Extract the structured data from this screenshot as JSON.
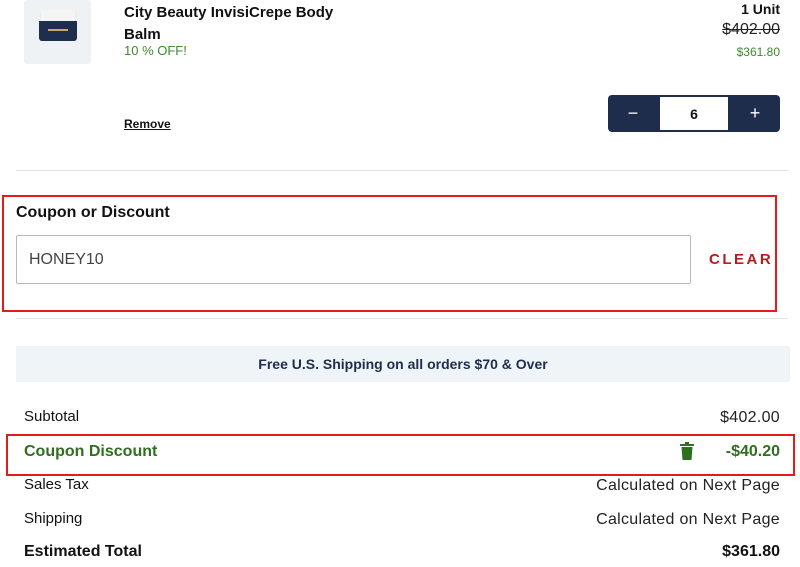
{
  "product": {
    "name": "City Beauty InvisiCrepe Body Balm",
    "discount_label": "10 % OFF!",
    "unit_label": "1 Unit",
    "original_price": "$402.00",
    "sale_price": "$361.80",
    "remove_label": "Remove",
    "quantity": "6",
    "minus_symbol": "−",
    "plus_symbol": "+"
  },
  "coupon": {
    "label": "Coupon or Discount",
    "value": "HONEY10",
    "clear_label": "CLEAR"
  },
  "banner": {
    "text": "Free U.S. Shipping on all orders $70 & Over"
  },
  "summary": {
    "subtotal_label": "Subtotal",
    "subtotal_value": "$402.00",
    "coupon_label": "Coupon Discount",
    "coupon_value": "-$40.20",
    "tax_label": "Sales Tax",
    "tax_value": "Calculated on Next Page",
    "shipping_label": "Shipping",
    "shipping_value": "Calculated on Next Page",
    "total_label": "Estimated Total",
    "total_value": "$361.80"
  },
  "icons": {
    "product_thumbnail": "product-jar-image",
    "trash": "trash-icon"
  },
  "colors": {
    "accent_navy": "#1f2d4d",
    "discount_green": "#3c8a2c",
    "coupon_green": "#2f6f1f",
    "clear_red": "#b01e1e",
    "highlight_red": "#e21b1b",
    "banner_bg": "#eef4f7"
  }
}
